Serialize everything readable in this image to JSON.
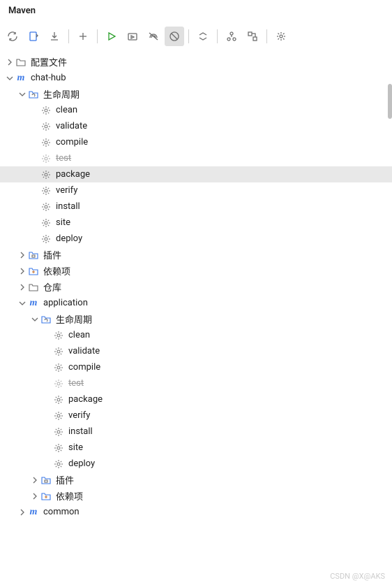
{
  "panel": {
    "title": "Maven"
  },
  "toolbar": {
    "refresh": "Refresh",
    "generate_sources": "Generate Sources",
    "download": "Download Sources",
    "add": "Add Maven Project",
    "run": "Run",
    "run_config": "Run Configurations",
    "offline": "Toggle Offline",
    "skip_tests": "Toggle Skip Tests",
    "collapse": "Collapse All",
    "show_deps": "Show Dependencies",
    "show_diagram": "Show Diagram",
    "settings": "Settings"
  },
  "tree": {
    "profiles": "配置文件",
    "root": "chat-hub",
    "lifecycle": "生命周期",
    "goals": {
      "clean": "clean",
      "validate": "validate",
      "compile": "compile",
      "test": "test",
      "package": "package",
      "verify": "verify",
      "install": "install",
      "site": "site",
      "deploy": "deploy"
    },
    "plugins": "插件",
    "dependencies": "依赖项",
    "repositories": "仓库",
    "module_application": "application",
    "module_common": "common"
  },
  "watermark": "CSDN @X@AKS"
}
